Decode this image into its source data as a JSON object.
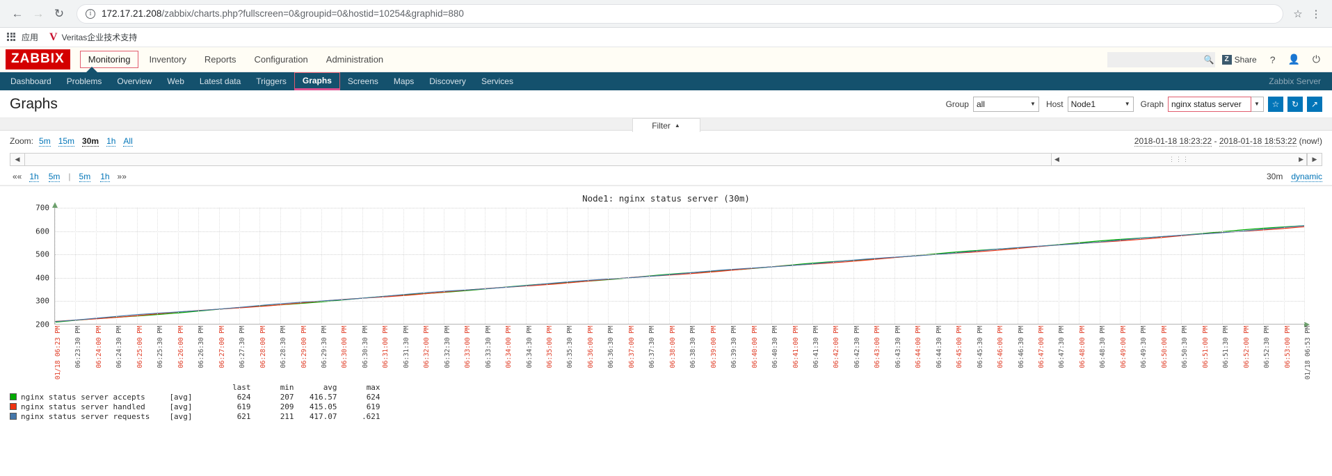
{
  "browser": {
    "back_icon": "back-arrow",
    "forward_icon": "forward-arrow",
    "reload_icon": "reload",
    "url_host": "172.17.21.208",
    "url_path": "/zabbix/charts.php?fullscreen=0&groupid=0&hostid=10254&graphid=880",
    "star_icon": "bookmark-star",
    "menu_icon": "kebab-menu",
    "bookmarks": {
      "apps_label": "应用",
      "items": [
        {
          "label": "Veritas企业技术支持",
          "favicon": "V"
        }
      ]
    }
  },
  "zabbix": {
    "logo": "ZABBIX",
    "menu": [
      {
        "label": "Monitoring",
        "selected": true
      },
      {
        "label": "Inventory",
        "selected": false
      },
      {
        "label": "Reports",
        "selected": false
      },
      {
        "label": "Configuration",
        "selected": false
      },
      {
        "label": "Administration",
        "selected": false
      }
    ],
    "search": {
      "value": "",
      "placeholder": ""
    },
    "search_icon": "search-icon",
    "share": {
      "label": "Share",
      "badge": "Z"
    },
    "help_label": "?",
    "user_icon": "user-icon",
    "logout_icon": "power-icon",
    "subnav": [
      {
        "label": "Dashboard",
        "active": false
      },
      {
        "label": "Problems",
        "active": false
      },
      {
        "label": "Overview",
        "active": false
      },
      {
        "label": "Web",
        "active": false
      },
      {
        "label": "Latest data",
        "active": false
      },
      {
        "label": "Triggers",
        "active": false
      },
      {
        "label": "Graphs",
        "active": true
      },
      {
        "label": "Screens",
        "active": false
      },
      {
        "label": "Maps",
        "active": false
      },
      {
        "label": "Discovery",
        "active": false
      },
      {
        "label": "Services",
        "active": false
      }
    ],
    "server_name": "Zabbix Server"
  },
  "page": {
    "title": "Graphs",
    "filters": {
      "group_label": "Group",
      "group_value": "all",
      "host_label": "Host",
      "host_value": "Node1",
      "graph_label": "Graph",
      "graph_value": "nginx status server"
    },
    "actions": {
      "favorite_icon": "star-icon",
      "refresh_icon": "refresh-icon",
      "fullscreen_icon": "expand-icon"
    },
    "filter_tab": {
      "label": "Filter",
      "caret": "▲"
    }
  },
  "timenav": {
    "zoom_label": "Zoom:",
    "zoom_options": [
      {
        "label": "5m",
        "active": false
      },
      {
        "label": "15m",
        "active": false
      },
      {
        "label": "30m",
        "active": true
      },
      {
        "label": "1h",
        "active": false
      },
      {
        "label": "All",
        "active": false
      }
    ],
    "date_from": "2018-01-18 18:23:22",
    "date_sep": " - ",
    "date_to": "2018-01-18 18:53:22",
    "date_now": "(now!)",
    "scroll_left_icon": "scroll-left-arrow",
    "scroll_right_icon": "scroll-right-arrow",
    "handle_grip": "⋮⋮⋮",
    "steps_left": [
      {
        "label": "««",
        "kind": "chev"
      },
      {
        "label": "1h",
        "kind": "link"
      },
      {
        "label": "5m",
        "kind": "link"
      },
      {
        "label": "|",
        "kind": "sep"
      },
      {
        "label": "5m",
        "kind": "link"
      },
      {
        "label": "1h",
        "kind": "link"
      },
      {
        "label": "»»",
        "kind": "chev"
      }
    ],
    "current_period": "30m",
    "dynamic_label": "dynamic"
  },
  "chart_data": {
    "type": "line",
    "title": "Node1: nginx status server (30m)",
    "xlabel": "",
    "ylabel": "",
    "ylim": [
      200,
      700
    ],
    "yticks": [
      200,
      300,
      400,
      500,
      600,
      700
    ],
    "grid": true,
    "legend_position": "bottom",
    "xticks": [
      "01/18 06:23 PM",
      "06:23:30 PM",
      "06:24:00 PM",
      "06:24:30 PM",
      "06:25:00 PM",
      "06:25:30 PM",
      "06:26:00 PM",
      "06:26:30 PM",
      "06:27:00 PM",
      "06:27:30 PM",
      "06:28:00 PM",
      "06:28:30 PM",
      "06:29:00 PM",
      "06:29:30 PM",
      "06:30:00 PM",
      "06:30:30 PM",
      "06:31:00 PM",
      "06:31:30 PM",
      "06:32:00 PM",
      "06:32:30 PM",
      "06:33:00 PM",
      "06:33:30 PM",
      "06:34:00 PM",
      "06:34:30 PM",
      "06:35:00 PM",
      "06:35:30 PM",
      "06:36:00 PM",
      "06:36:30 PM",
      "06:37:00 PM",
      "06:37:30 PM",
      "06:38:00 PM",
      "06:38:30 PM",
      "06:39:00 PM",
      "06:39:30 PM",
      "06:40:00 PM",
      "06:40:30 PM",
      "06:41:00 PM",
      "06:41:30 PM",
      "06:42:00 PM",
      "06:42:30 PM",
      "06:43:00 PM",
      "06:43:30 PM",
      "06:44:00 PM",
      "06:44:30 PM",
      "06:45:00 PM",
      "06:45:30 PM",
      "06:46:00 PM",
      "06:46:30 PM",
      "06:47:00 PM",
      "06:47:30 PM",
      "06:48:00 PM",
      "06:48:30 PM",
      "06:49:00 PM",
      "06:49:30 PM",
      "06:50:00 PM",
      "06:50:30 PM",
      "06:51:00 PM",
      "06:51:30 PM",
      "06:52:00 PM",
      "06:52:30 PM",
      "06:53:00 PM",
      "01/18 06:53 PM"
    ],
    "series": [
      {
        "name": "nginx status server accepts",
        "color": "#00aa00",
        "aggregate": "[avg]",
        "start": 207,
        "end": 624,
        "values": [
          207,
          624
        ]
      },
      {
        "name": "nginx status server handled",
        "color": "#ee3311",
        "aggregate": "[avg]",
        "start": 209,
        "end": 619,
        "values": [
          209,
          619
        ]
      },
      {
        "name": "nginx status server requests",
        "color": "#4477aa",
        "aggregate": "[avg]",
        "start": 211,
        "end": 621,
        "values": [
          211,
          621
        ]
      }
    ],
    "legend_headers": [
      "",
      "",
      "last",
      "min",
      "avg",
      "max"
    ],
    "legend_rows": [
      {
        "color": "#00aa00",
        "name": "nginx status server accepts",
        "fn": "[avg]",
        "last": "624",
        "min": "207",
        "avg": "416.57",
        "max": "624"
      },
      {
        "color": "#ee3311",
        "name": "nginx status server handled",
        "fn": "[avg]",
        "last": "619",
        "min": "209",
        "avg": "415.05",
        "max": "619"
      },
      {
        "color": "#4477aa",
        "name": "nginx status server requests",
        "fn": "[avg]",
        "last": "621",
        "min": "211",
        "avg": "417.07",
        "max": ".621"
      }
    ]
  }
}
